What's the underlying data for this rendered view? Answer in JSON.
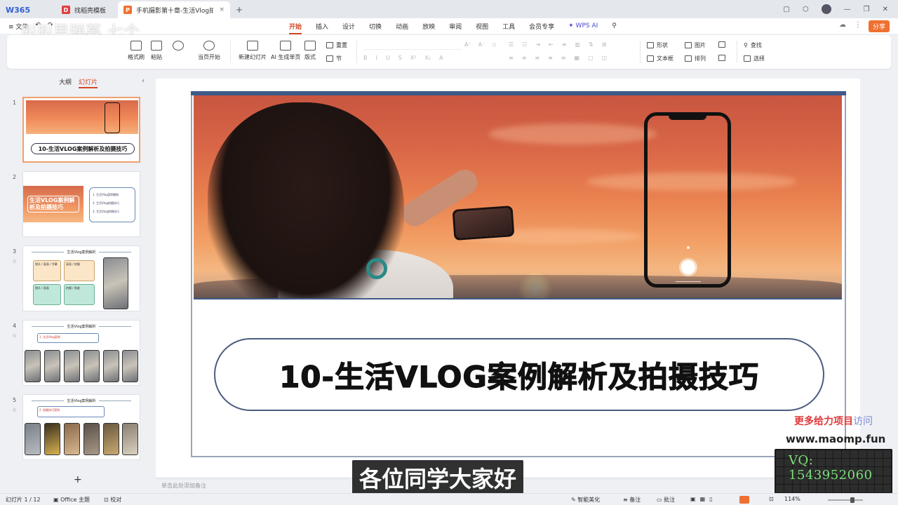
{
  "tabs": {
    "brand": "W365",
    "doc_tab": "找稻壳模板",
    "active_tab": "手机摄影第十章-生活Vlog拍",
    "close": "×",
    "new_tab": "+"
  },
  "menu": {
    "file": "≡ 文件",
    "items": [
      "开始",
      "插入",
      "设计",
      "切换",
      "动画",
      "放映",
      "审阅",
      "视图",
      "工具",
      "会员专享",
      "✦ WPS AI"
    ],
    "active_index": 0,
    "share": "分享"
  },
  "watermark_left": "叫叫里弹幕 七个",
  "ribbon": {
    "format_painter": "格式刷",
    "paste": "粘贴",
    "from_current": "当页开始",
    "new_slide": "新建幻灯片",
    "ai_slide": "AI 生成单页",
    "layout": "版式",
    "reset": "重置",
    "section": "节",
    "shape": "形状",
    "picture": "图片",
    "textbox": "文本框",
    "arrange": "排列",
    "find": "查找",
    "select": "选择"
  },
  "left_panel": {
    "outline_tab": "大纲",
    "slides_tab": "幻灯片",
    "slide_numbers": [
      "1",
      "2",
      "3",
      "4",
      "5"
    ],
    "thumb1_title": "10-生活VLOG案例解析及拍摄技巧",
    "thumb2_title": "生活VLOG案例解析及拍摄技巧",
    "thumb2_items": [
      "1. 生活Vlog案例解析",
      "2. 生活Vlog拍摄技巧",
      "3. 生活Vlog剪辑技巧"
    ],
    "thumb_heading": "生活Vlog案例解析",
    "thumb3_boxes": [
      "镜头 / 画面 / 字幕",
      "画面 / 拍摄",
      "镜头 / 画面",
      "拍摄 / 角度"
    ],
    "thumb4_caption": "1. 生活Vlog案例",
    "thumb5_caption": "2. 拍摄技巧案例",
    "add_slide": "+"
  },
  "slide": {
    "title": "10-生活VLOG案例解析及拍摄技巧"
  },
  "notes_placeholder": "单击此处添加备注",
  "overlay": {
    "subtitle": "各位同学大家好",
    "promo_text": "更多给力项目",
    "promo_visit": "访问",
    "promo_url": "www.maomp.fun",
    "promo_qq": "VQ: 1543952060"
  },
  "status": {
    "slide_index": "幻灯片 1 / 12",
    "theme": "Office 主题",
    "proofread": "校对",
    "smart_beautify": "智能美化",
    "notes": "备注",
    "comments": "批注",
    "zoom": "114%"
  },
  "colors": {
    "accent": "#d24726",
    "frame": "#3e5a88"
  }
}
